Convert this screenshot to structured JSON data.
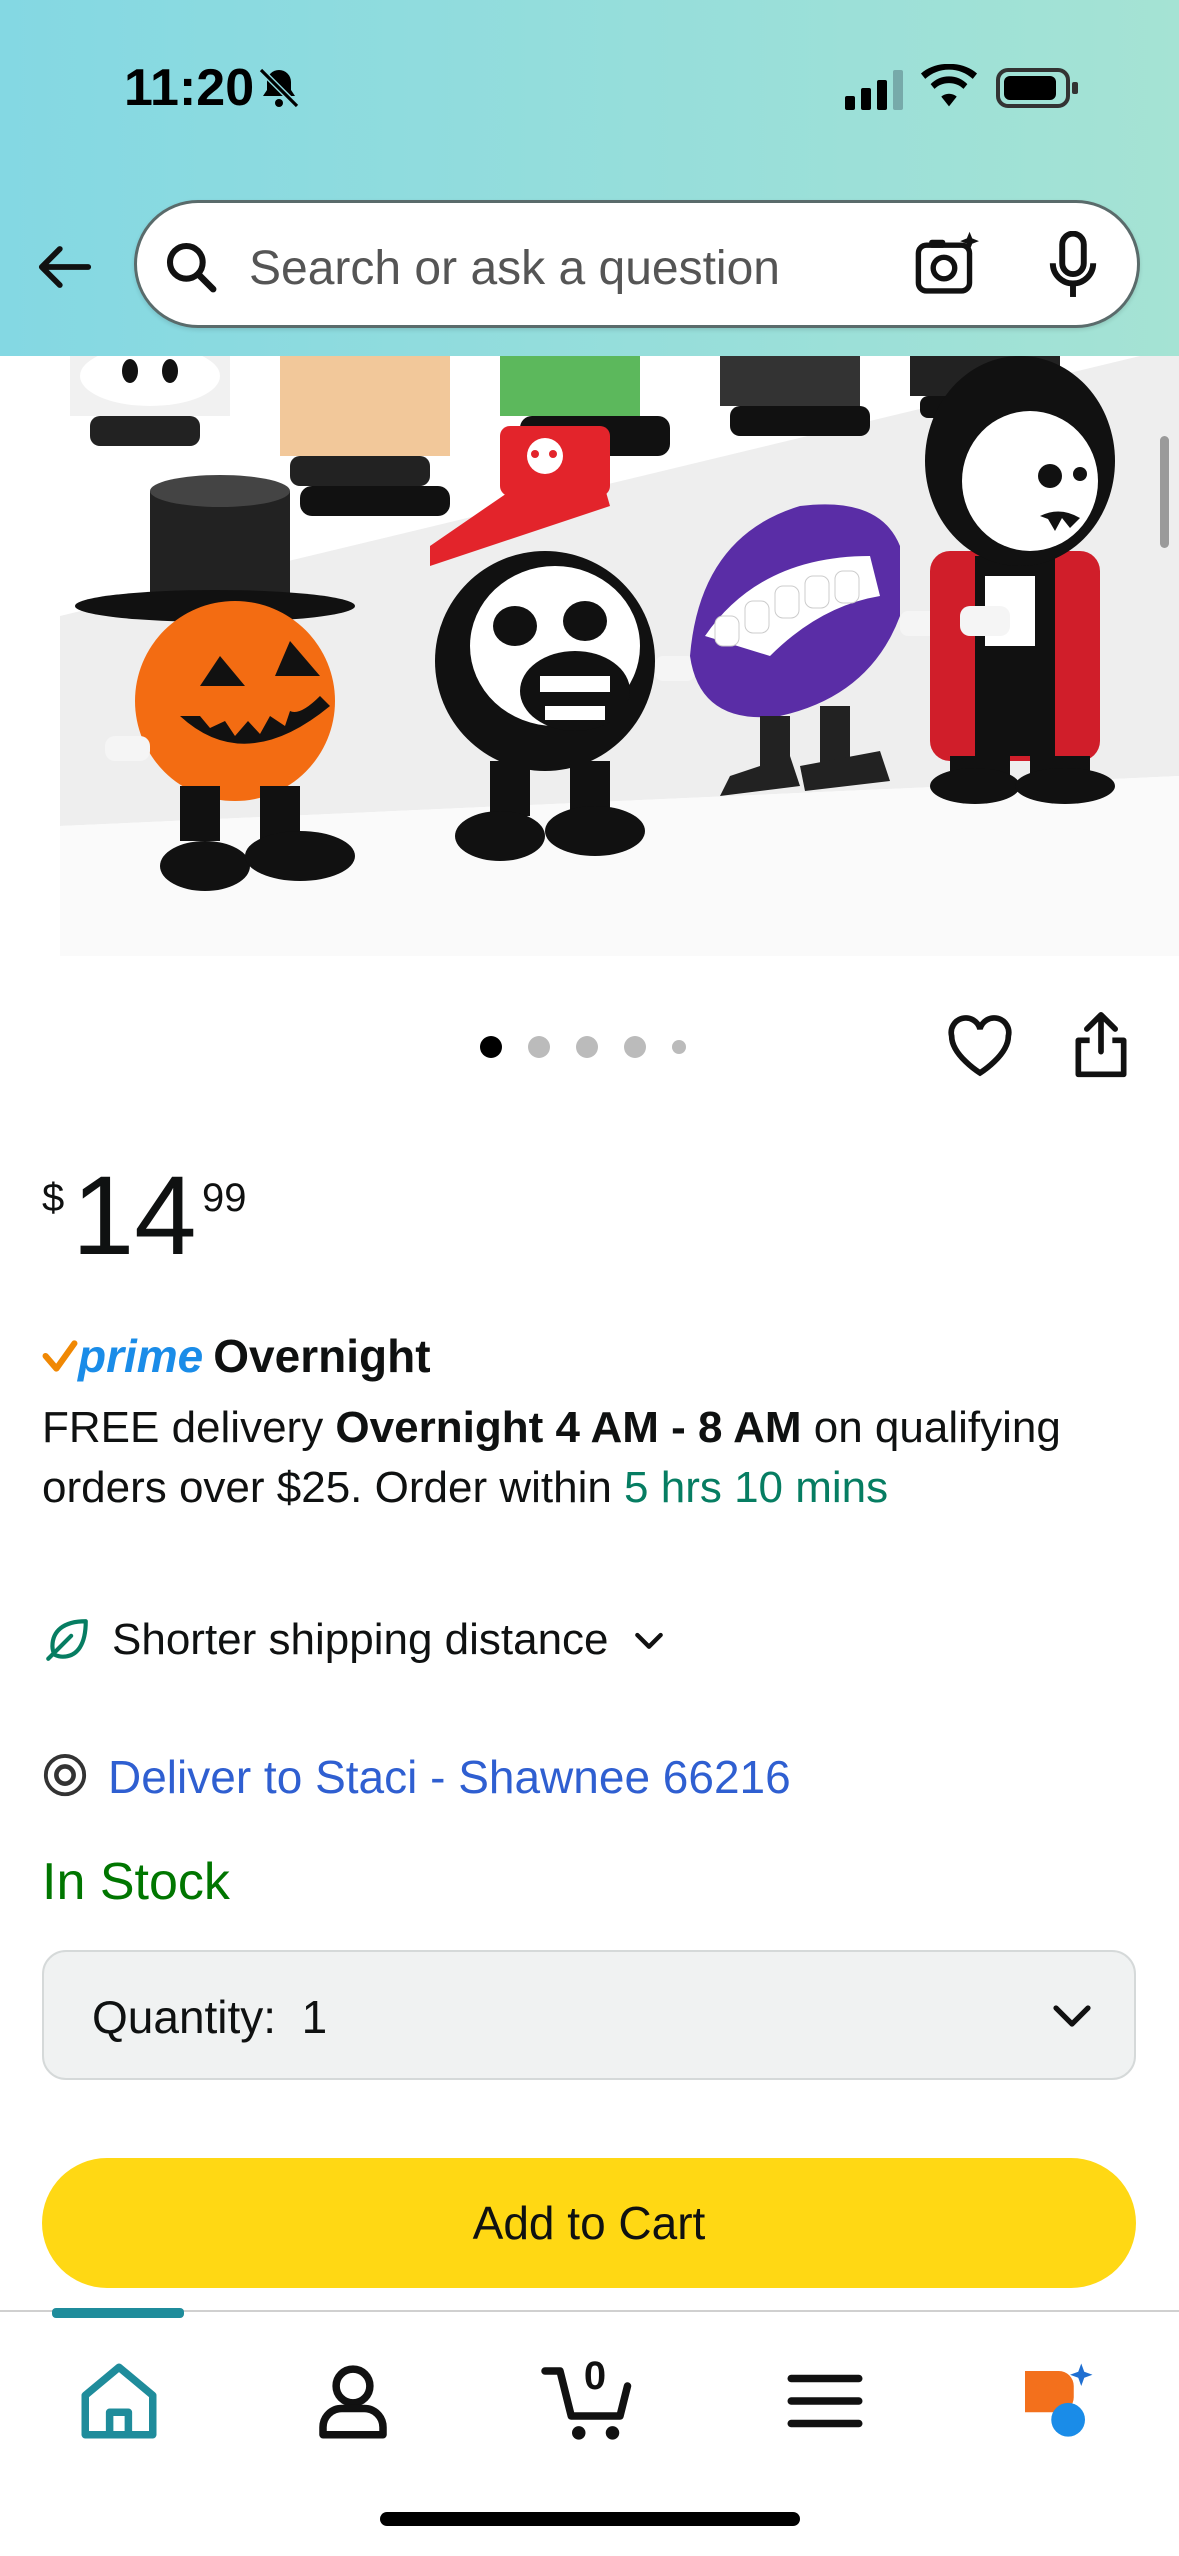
{
  "status_bar": {
    "time": "11:20"
  },
  "search": {
    "placeholder": "Search or ask a question"
  },
  "carousel": {
    "total": 5,
    "active_index": 0
  },
  "product": {
    "price_currency": "$",
    "price_whole": "14",
    "price_fraction": "99"
  },
  "prime": {
    "logo_text": "prime",
    "label": "Overnight"
  },
  "delivery": {
    "prefix": "FREE delivery ",
    "window": "Overnight 4 AM - 8 AM",
    "middle": " on qualifying orders over $25. Order within ",
    "countdown": "5 hrs 10 mins"
  },
  "shipping": {
    "label": "Shorter shipping distance"
  },
  "deliver_to": {
    "label": "Deliver to Staci - Shawnee 66216"
  },
  "stock": {
    "status": "In Stock"
  },
  "quantity": {
    "label": "Quantity:",
    "value": "1"
  },
  "add_to_cart": {
    "label": "Add to Cart"
  },
  "bottom_nav": {
    "items": [
      "home-icon",
      "account-icon",
      "cart-icon",
      "menu-icon",
      "rufus-icon"
    ],
    "cart_count": "0",
    "active": "home"
  },
  "colors": {
    "header_gradient_start": "#84d8e3",
    "header_gradient_end": "#a5e3d4",
    "add_to_cart_bg": "#ffd814",
    "in_stock": "#007600",
    "link_blue": "#2f5fd1",
    "countdown_green": "#067d62",
    "prime_blue": "#1a8ce8",
    "active_nav": "#1f8c9b"
  }
}
